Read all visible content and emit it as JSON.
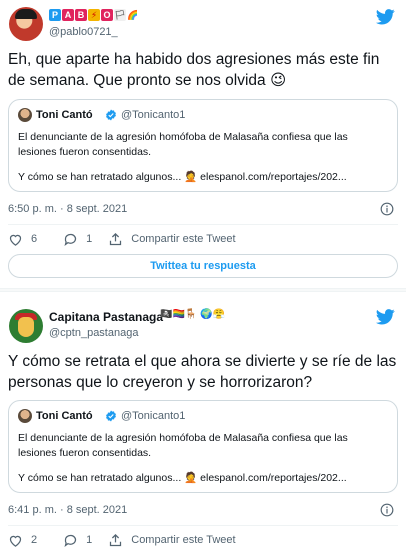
{
  "tweet1": {
    "author_handle": "@pablo0721_",
    "author_badges": [
      "P",
      "A",
      "B",
      "⚡",
      "O",
      "🏳",
      "🌈"
    ],
    "text": "Eh, que aparte ha habido dos agresiones más este fin de semana. Que pronto se nos olvida 😉",
    "quote": {
      "name": "Toni Cantó",
      "handle": "@Tonicanto1",
      "line1": "El denunciante de la agresión homófoba de Malasaña confiesa que las lesiones fueron consentidas.",
      "line2": "Y cómo se han retratado algunos... 🤦 elespanol.com/reportajes/202..."
    },
    "timestamp": "6:50 p. m. · 8 sept. 2021",
    "likes": "6",
    "replies": "1",
    "share_label": "Compartir este Tweet",
    "reply_button": "Twittea tu respuesta"
  },
  "tweet2": {
    "author_name": "Capitana Pastanaga",
    "author_handle": "@cptn_pastanaga",
    "author_emojis": "🏴‍☠️🏳️‍🌈🪑 🌍😤",
    "text": "Y cómo se retrata el que ahora se divierte y se ríe de las personas que lo creyeron y se horrorizaron?",
    "quote": {
      "name": "Toni Cantó",
      "handle": "@Tonicanto1",
      "line1": "El denunciante de la agresión homófoba de Malasaña confiesa que las lesiones fueron consentidas.",
      "line2": "Y cómo se han retratado algunos... 🤦 elespanol.com/reportajes/202..."
    },
    "timestamp": "6:41 p. m. · 8 sept. 2021",
    "likes": "2",
    "replies": "1",
    "share_label": "Compartir este Tweet"
  },
  "colors": {
    "twitter_blue": "#1d9bf0",
    "secondary_text": "#536471",
    "border": "#cfd9de"
  }
}
